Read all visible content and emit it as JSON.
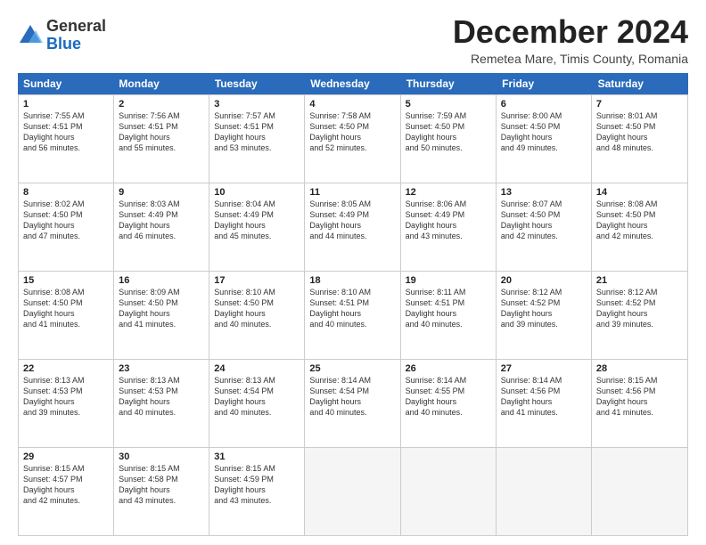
{
  "logo": {
    "general": "General",
    "blue": "Blue"
  },
  "title": "December 2024",
  "subtitle": "Remetea Mare, Timis County, Romania",
  "header_days": [
    "Sunday",
    "Monday",
    "Tuesday",
    "Wednesday",
    "Thursday",
    "Friday",
    "Saturday"
  ],
  "weeks": [
    [
      {
        "day": "1",
        "sunrise": "7:55 AM",
        "sunset": "4:51 PM",
        "daylight": "8 hours and 56 minutes."
      },
      {
        "day": "2",
        "sunrise": "7:56 AM",
        "sunset": "4:51 PM",
        "daylight": "8 hours and 55 minutes."
      },
      {
        "day": "3",
        "sunrise": "7:57 AM",
        "sunset": "4:51 PM",
        "daylight": "8 hours and 53 minutes."
      },
      {
        "day": "4",
        "sunrise": "7:58 AM",
        "sunset": "4:50 PM",
        "daylight": "8 hours and 52 minutes."
      },
      {
        "day": "5",
        "sunrise": "7:59 AM",
        "sunset": "4:50 PM",
        "daylight": "8 hours and 50 minutes."
      },
      {
        "day": "6",
        "sunrise": "8:00 AM",
        "sunset": "4:50 PM",
        "daylight": "8 hours and 49 minutes."
      },
      {
        "day": "7",
        "sunrise": "8:01 AM",
        "sunset": "4:50 PM",
        "daylight": "8 hours and 48 minutes."
      }
    ],
    [
      {
        "day": "8",
        "sunrise": "8:02 AM",
        "sunset": "4:50 PM",
        "daylight": "8 hours and 47 minutes."
      },
      {
        "day": "9",
        "sunrise": "8:03 AM",
        "sunset": "4:49 PM",
        "daylight": "8 hours and 46 minutes."
      },
      {
        "day": "10",
        "sunrise": "8:04 AM",
        "sunset": "4:49 PM",
        "daylight": "8 hours and 45 minutes."
      },
      {
        "day": "11",
        "sunrise": "8:05 AM",
        "sunset": "4:49 PM",
        "daylight": "8 hours and 44 minutes."
      },
      {
        "day": "12",
        "sunrise": "8:06 AM",
        "sunset": "4:49 PM",
        "daylight": "8 hours and 43 minutes."
      },
      {
        "day": "13",
        "sunrise": "8:07 AM",
        "sunset": "4:50 PM",
        "daylight": "8 hours and 42 minutes."
      },
      {
        "day": "14",
        "sunrise": "8:08 AM",
        "sunset": "4:50 PM",
        "daylight": "8 hours and 42 minutes."
      }
    ],
    [
      {
        "day": "15",
        "sunrise": "8:08 AM",
        "sunset": "4:50 PM",
        "daylight": "8 hours and 41 minutes."
      },
      {
        "day": "16",
        "sunrise": "8:09 AM",
        "sunset": "4:50 PM",
        "daylight": "8 hours and 41 minutes."
      },
      {
        "day": "17",
        "sunrise": "8:10 AM",
        "sunset": "4:50 PM",
        "daylight": "8 hours and 40 minutes."
      },
      {
        "day": "18",
        "sunrise": "8:10 AM",
        "sunset": "4:51 PM",
        "daylight": "8 hours and 40 minutes."
      },
      {
        "day": "19",
        "sunrise": "8:11 AM",
        "sunset": "4:51 PM",
        "daylight": "8 hours and 40 minutes."
      },
      {
        "day": "20",
        "sunrise": "8:12 AM",
        "sunset": "4:52 PM",
        "daylight": "8 hours and 39 minutes."
      },
      {
        "day": "21",
        "sunrise": "8:12 AM",
        "sunset": "4:52 PM",
        "daylight": "8 hours and 39 minutes."
      }
    ],
    [
      {
        "day": "22",
        "sunrise": "8:13 AM",
        "sunset": "4:53 PM",
        "daylight": "8 hours and 39 minutes."
      },
      {
        "day": "23",
        "sunrise": "8:13 AM",
        "sunset": "4:53 PM",
        "daylight": "8 hours and 40 minutes."
      },
      {
        "day": "24",
        "sunrise": "8:13 AM",
        "sunset": "4:54 PM",
        "daylight": "8 hours and 40 minutes."
      },
      {
        "day": "25",
        "sunrise": "8:14 AM",
        "sunset": "4:54 PM",
        "daylight": "8 hours and 40 minutes."
      },
      {
        "day": "26",
        "sunrise": "8:14 AM",
        "sunset": "4:55 PM",
        "daylight": "8 hours and 40 minutes."
      },
      {
        "day": "27",
        "sunrise": "8:14 AM",
        "sunset": "4:56 PM",
        "daylight": "8 hours and 41 minutes."
      },
      {
        "day": "28",
        "sunrise": "8:15 AM",
        "sunset": "4:56 PM",
        "daylight": "8 hours and 41 minutes."
      }
    ],
    [
      {
        "day": "29",
        "sunrise": "8:15 AM",
        "sunset": "4:57 PM",
        "daylight": "8 hours and 42 minutes."
      },
      {
        "day": "30",
        "sunrise": "8:15 AM",
        "sunset": "4:58 PM",
        "daylight": "8 hours and 43 minutes."
      },
      {
        "day": "31",
        "sunrise": "8:15 AM",
        "sunset": "4:59 PM",
        "daylight": "8 hours and 43 minutes."
      },
      null,
      null,
      null,
      null
    ]
  ]
}
